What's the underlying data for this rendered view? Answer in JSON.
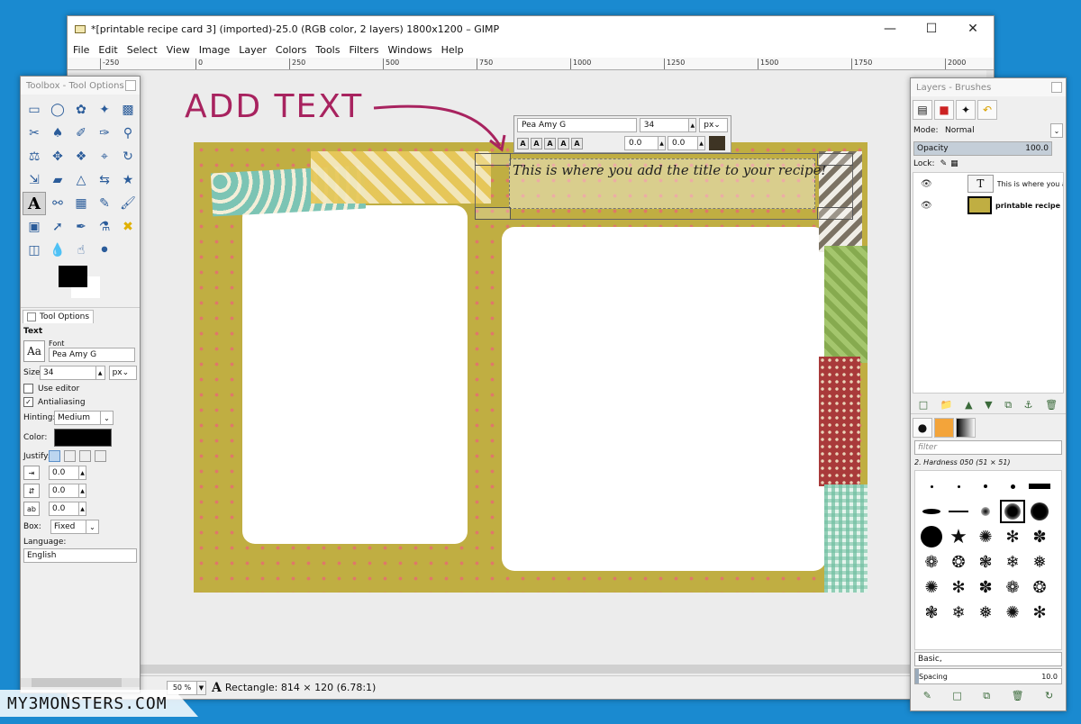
{
  "main_window": {
    "title": "*[printable recipe card 3] (imported)-25.0 (RGB color, 2 layers) 1800x1200 – GIMP",
    "menu": [
      "File",
      "Edit",
      "Select",
      "View",
      "Image",
      "Layer",
      "Colors",
      "Tools",
      "Filters",
      "Windows",
      "Help"
    ],
    "ruler_marks": [
      "-250",
      "0",
      "250",
      "500",
      "750",
      "1000",
      "1250",
      "1500",
      "1750",
      "2000"
    ],
    "status": {
      "zoom": "50 %",
      "message": "Rectangle: 814 × 120  (6.78:1)"
    }
  },
  "annotation": {
    "text": "ADD TEXT",
    "color": "#a8235f"
  },
  "canvas": {
    "text_layer_content": "This is where you add the title to your recipe!"
  },
  "text_toolbar": {
    "font": "Pea Amy G",
    "size": "34",
    "unit": "px",
    "baseline": "0.0",
    "kerning": "0.0",
    "style_buttons": [
      "A",
      "A",
      "A",
      "A",
      "A"
    ]
  },
  "toolbox": {
    "title": "Toolbox - Tool Options",
    "tool_icons": [
      "rect-select",
      "ellipse-select",
      "free-select",
      "fuzzy-select",
      "select-by-color",
      "scissors",
      "foreground-select",
      "paths",
      "color-picker",
      "zoom",
      "measure",
      "move",
      "align",
      "crop",
      "transform",
      "scale",
      "shear",
      "perspective",
      "flip",
      "cage",
      "text",
      "heal",
      "blend",
      "pencil",
      "paintbrush",
      "eraser",
      "airbrush",
      "ink",
      "clone",
      "smudge",
      "bucket-fill",
      "dodge-burn",
      "blur",
      "dodge",
      "smudge-tool"
    ],
    "tool_options_tab": "Tool Options",
    "section": "Text",
    "font_label": "Font",
    "font_value": "Pea Amy G",
    "size_label": "Size:",
    "size_value": "34",
    "size_unit": "px",
    "use_editor": "Use editor",
    "antialiasing": "Antialiasing",
    "hinting_label": "Hinting:",
    "hinting_value": "Medium",
    "color_label": "Color:",
    "justify_label": "Justify:",
    "indent_value": "0.0",
    "line_spacing_value": "0.0",
    "letter_spacing_value": "0.0",
    "box_label": "Box:",
    "box_value": "Fixed",
    "language_label": "Language:",
    "language_value": "English"
  },
  "layers_dock": {
    "title": "Layers - Brushes",
    "mode_label": "Mode:",
    "mode_value": "Normal",
    "opacity_label": "Opacity",
    "opacity_value": "100.0",
    "lock_label": "Lock:",
    "layers": [
      {
        "name": "This is where you a",
        "thumb": "T"
      },
      {
        "name": "printable recipe ca",
        "thumb": ""
      }
    ],
    "brush_filter_placeholder": "filter",
    "brush_name": "2. Hardness 050 (51 × 51)",
    "brush_tag": "Basic,",
    "spacing_label": "Spacing",
    "spacing_value": "10.0"
  },
  "watermark": "MY3MONSTERS.COM"
}
